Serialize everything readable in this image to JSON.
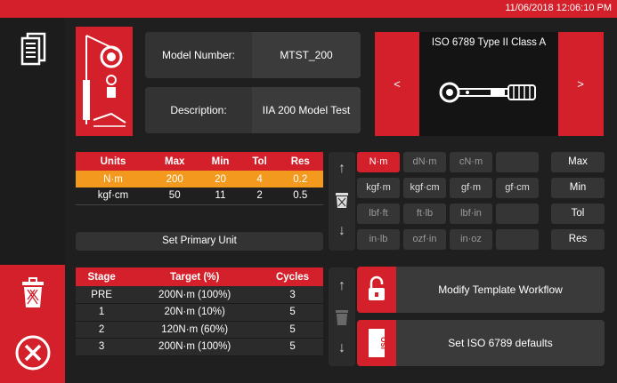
{
  "status_bar": {
    "datetime": "11/06/2018 12:06:10 PM"
  },
  "model": {
    "model_number_label": "Model Number:",
    "model_number_value": "MTST_200",
    "description_label": "Description:",
    "description_value": "IIA 200 Model Test"
  },
  "iso_panel": {
    "title": "ISO 6789 Type II Class A",
    "prev": "<",
    "next": ">"
  },
  "units_table": {
    "headers": [
      "Units",
      "Max",
      "Min",
      "Tol",
      "Res"
    ],
    "rows": [
      [
        "N·m",
        "200",
        "20",
        "4",
        "0.2"
      ],
      [
        "kgf·cm",
        "50",
        "11",
        "2",
        "0.5"
      ]
    ],
    "set_primary_label": "Set Primary Unit"
  },
  "unit_buttons": [
    [
      "N·m",
      "dN·m",
      "cN·m",
      ""
    ],
    [
      "kgf·m",
      "kgf·cm",
      "gf·m",
      "gf·cm"
    ],
    [
      "lbf·ft",
      "ft·lb",
      "lbf·in",
      ""
    ],
    [
      "in·lb",
      "ozf·in",
      "in·oz",
      ""
    ]
  ],
  "side_buttons": [
    "Max",
    "Min",
    "Tol",
    "Res"
  ],
  "stage_table": {
    "headers": [
      "Stage",
      "Target (%)",
      "Cycles"
    ],
    "rows": [
      [
        "PRE",
        "200N·m (100%)",
        "3"
      ],
      [
        "1",
        "20N·m (10%)",
        "5"
      ],
      [
        "2",
        "120N·m (60%)",
        "5"
      ],
      [
        "3",
        "200N·m (100%)",
        "5"
      ]
    ]
  },
  "actions": {
    "modify_workflow": "Modify Template Workflow",
    "set_iso_defaults": "Set ISO 6789 defaults",
    "iso_badge": "ISO"
  },
  "arrows": {
    "up": "↑",
    "down": "↓"
  },
  "colors": {
    "accent": "#d4202a",
    "selected_row": "#f39a1e",
    "background": "#1f1f1f"
  }
}
